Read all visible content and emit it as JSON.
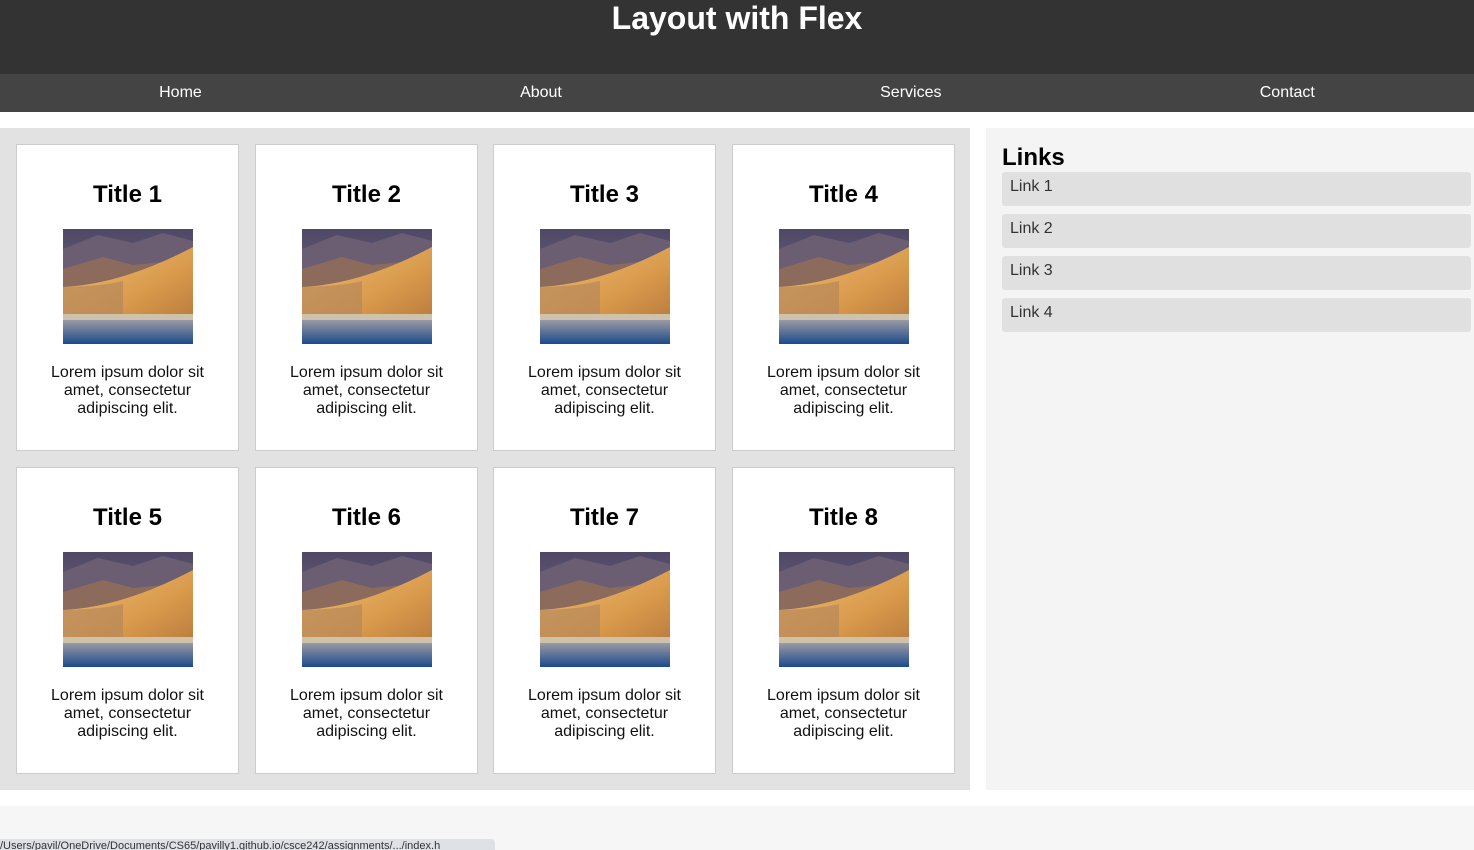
{
  "header": {
    "title": "Layout with Flex"
  },
  "nav": {
    "items": [
      {
        "label": "Home"
      },
      {
        "label": "About"
      },
      {
        "label": "Services"
      },
      {
        "label": "Contact"
      }
    ]
  },
  "cards": [
    {
      "title": "Title 1",
      "text": "Lorem ipsum dolor sit amet, consectetur adipiscing elit."
    },
    {
      "title": "Title 2",
      "text": "Lorem ipsum dolor sit amet, consectetur adipiscing elit."
    },
    {
      "title": "Title 3",
      "text": "Lorem ipsum dolor sit amet, consectetur adipiscing elit."
    },
    {
      "title": "Title 4",
      "text": "Lorem ipsum dolor sit amet, consectetur adipiscing elit."
    },
    {
      "title": "Title 5",
      "text": "Lorem ipsum dolor sit amet, consectetur adipiscing elit."
    },
    {
      "title": "Title 6",
      "text": "Lorem ipsum dolor sit amet, consectetur adipiscing elit."
    },
    {
      "title": "Title 7",
      "text": "Lorem ipsum dolor sit amet, consectetur adipiscing elit."
    },
    {
      "title": "Title 8",
      "text": "Lorem ipsum dolor sit amet, consectetur adipiscing elit."
    }
  ],
  "sidebar": {
    "heading": "Links",
    "links": [
      {
        "label": "Link 1"
      },
      {
        "label": "Link 2"
      },
      {
        "label": "Link 3"
      },
      {
        "label": "Link 4"
      }
    ]
  },
  "status_bar": {
    "url": "/Users/pavil/OneDrive/Documents/CS65/pavilly1.github.io/csce242/assignments/.../index.h"
  },
  "colors": {
    "header_bg": "#333333",
    "nav_bg": "#444444",
    "content_bg": "#e2e2e2",
    "sidebar_bg": "#f4f4f4",
    "link_bg": "#e0e0e0"
  }
}
